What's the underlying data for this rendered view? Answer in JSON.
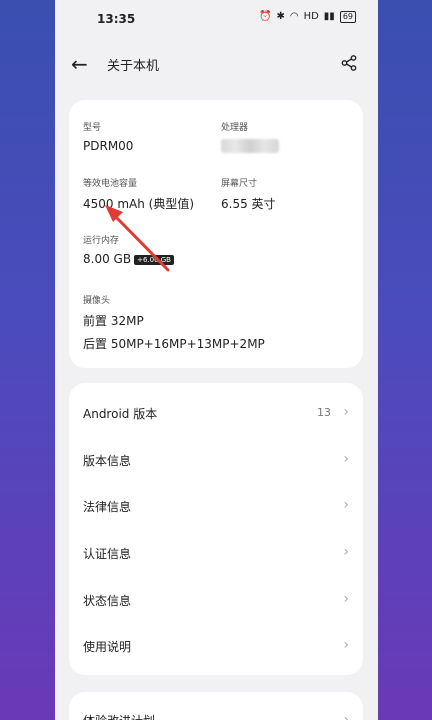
{
  "status": {
    "time": "13:35",
    "battery": "69"
  },
  "header": {
    "title": "关于本机"
  },
  "specs": {
    "model_label": "型号",
    "model_value": "PDRM00",
    "cpu_label": "处理器",
    "battery_label": "等效电池容量",
    "battery_value": "4500 mAh (典型值)",
    "screen_label": "屏幕尺寸",
    "screen_value": "6.55 英寸",
    "ram_label": "运行内存",
    "ram_value": "8.00 GB",
    "ram_badge": "+6.00 GB",
    "camera_label": "摄像头",
    "camera_front": "前置 32MP",
    "camera_rear": "后置 50MP+16MP+13MP+2MP"
  },
  "menu": {
    "android_label": "Android 版本",
    "android_value": "13",
    "version_label": "版本信息",
    "legal_label": "法律信息",
    "cert_label": "认证信息",
    "status_label": "状态信息",
    "manual_label": "使用说明"
  },
  "bottom": {
    "label": "体验改进计划"
  },
  "colors": {
    "background_top": "#3a4fb0",
    "background_bottom": "#6a39b8",
    "annotation_arrow": "#e53935"
  }
}
